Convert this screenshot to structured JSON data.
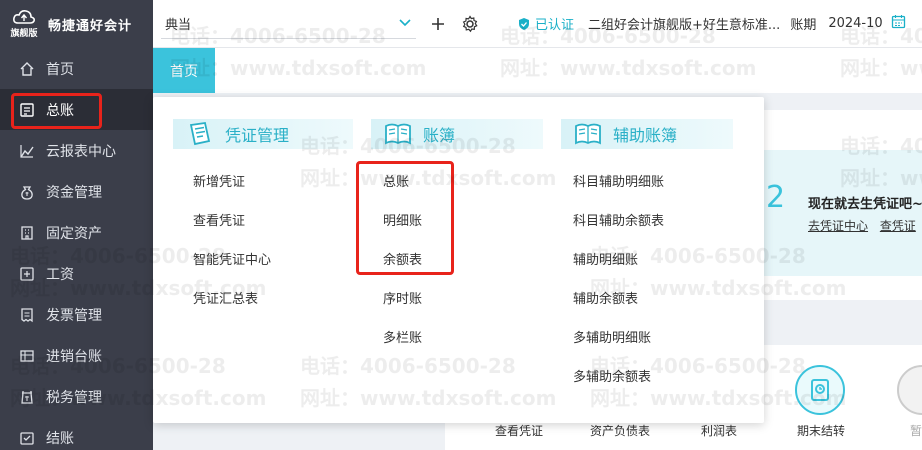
{
  "brand": {
    "name": "畅捷通好会计",
    "edition": "旗舰版"
  },
  "sidebar": {
    "items": [
      {
        "label": "首页",
        "icon": "home-icon"
      },
      {
        "label": "总账",
        "icon": "ledger-icon",
        "active": true,
        "highlighted": true
      },
      {
        "label": "云报表中心",
        "icon": "chart-icon"
      },
      {
        "label": "资金管理",
        "icon": "money-bag-icon"
      },
      {
        "label": "固定资产",
        "icon": "building-icon"
      },
      {
        "label": "工资",
        "icon": "payroll-icon"
      },
      {
        "label": "发票管理",
        "icon": "invoice-icon"
      },
      {
        "label": "进销台账",
        "icon": "inventory-icon"
      },
      {
        "label": "税务管理",
        "icon": "tax-icon"
      },
      {
        "label": "结账",
        "icon": "checkout-icon"
      }
    ]
  },
  "topbar": {
    "company": "典当",
    "certified": "已认证",
    "product": "二组好会计旗舰版+好生意标准...",
    "period_label": "账期",
    "period_value": "2024-10"
  },
  "tabs": {
    "home": "首页"
  },
  "dropdown": {
    "columns": [
      {
        "title": "凭证管理",
        "icon": "voucher-icon",
        "items": [
          "新增凭证",
          "查看凭证",
          "智能凭证中心",
          "凭证汇总表"
        ]
      },
      {
        "title": "账簿",
        "icon": "book-icon",
        "items": [
          "总账",
          "明细账",
          "余额表",
          "序时账",
          "多栏账"
        ]
      },
      {
        "title": "辅助账簿",
        "icon": "book-icon",
        "items": [
          "科目辅助明细账",
          "科目辅助余额表",
          "辅助明细账",
          "辅助余额表",
          "多辅助明细账",
          "多辅助余额表"
        ]
      }
    ]
  },
  "guide": {
    "step_number": "2",
    "title": "现在就去生凭证吧~",
    "links": [
      "去凭证中心",
      "查凭证"
    ]
  },
  "quick_actions": [
    "查看凭证",
    "资产负债表",
    "利润表",
    "期末结转",
    "暂"
  ],
  "watermark": {
    "phone": "电话：4006-6500-28",
    "site": "网址：www.tdxsoft.com"
  },
  "colors": {
    "sidebar_bg": "#3b3e4a",
    "accent": "#3bc3dc",
    "highlight_red": "#e8231b"
  }
}
